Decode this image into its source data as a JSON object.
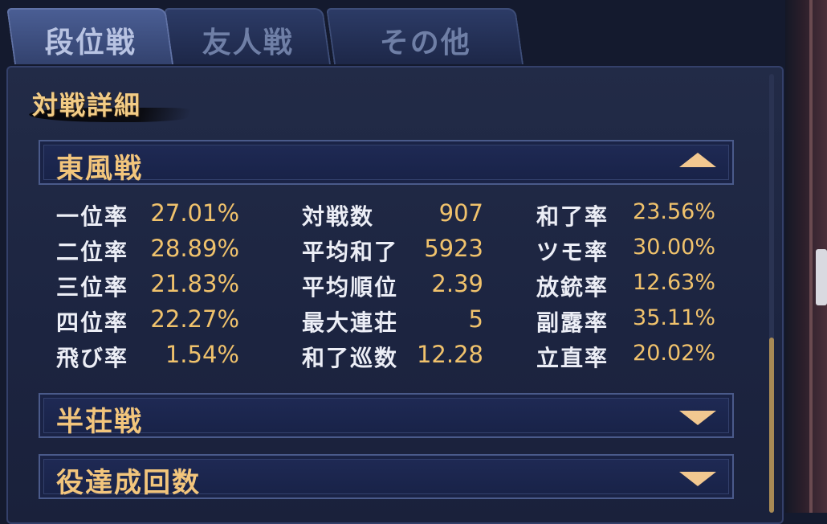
{
  "tabs": [
    {
      "label": "段位戦"
    },
    {
      "label": "友人戦"
    },
    {
      "label": "その他"
    }
  ],
  "section_title": "対戦詳細",
  "headers": [
    {
      "label": "東風戦"
    },
    {
      "label": "半荘戦"
    },
    {
      "label": "役達成回数"
    }
  ],
  "stats": [
    [
      {
        "label": "一位率",
        "value": "27.01%"
      },
      {
        "label": "対戦数",
        "value": "907"
      },
      {
        "label": "和了率",
        "value": "23.56%"
      }
    ],
    [
      {
        "label": "二位率",
        "value": "28.89%"
      },
      {
        "label": "平均和了",
        "value": "5923"
      },
      {
        "label": "ツモ率",
        "value": "30.00%"
      }
    ],
    [
      {
        "label": "三位率",
        "value": "21.83%"
      },
      {
        "label": "平均順位",
        "value": "2.39"
      },
      {
        "label": "放銃率",
        "value": "12.63%"
      }
    ],
    [
      {
        "label": "四位率",
        "value": "22.27%"
      },
      {
        "label": "最大連荘",
        "value": "5"
      },
      {
        "label": "副露率",
        "value": "35.11%"
      }
    ],
    [
      {
        "label": "飛び率",
        "value": "1.54%"
      },
      {
        "label": "和了巡数",
        "value": "12.28"
      },
      {
        "label": "立直率",
        "value": "20.02%"
      }
    ]
  ]
}
